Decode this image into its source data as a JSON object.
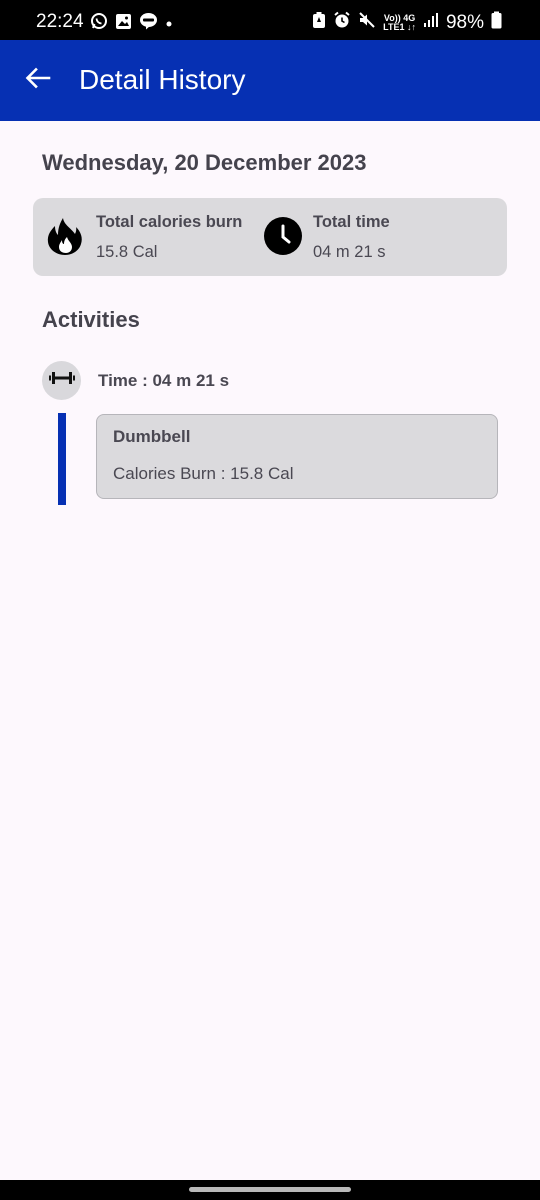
{
  "status_bar": {
    "time": "22:24",
    "battery": "98%",
    "network_top": "Vo)) 4G",
    "network_bottom": "LTE1 ↓↑"
  },
  "app_bar": {
    "title": "Detail History",
    "color": "#0630b3"
  },
  "date_heading": "Wednesday, 20 December 2023",
  "summary": {
    "calories_label": "Total calories burn",
    "calories_value": "15.8 Cal",
    "time_label": "Total time",
    "time_value": "04 m 21 s"
  },
  "activities_heading": "Activities",
  "activities": [
    {
      "time": "Time : 04 m 21 s",
      "name": "Dumbbell",
      "calories": "Calories Burn : 15.8 Cal",
      "icon": "dumbbell-icon"
    }
  ],
  "icons": {
    "back": "arrow-left-icon",
    "calories": "fire-icon",
    "time": "clock-icon"
  }
}
